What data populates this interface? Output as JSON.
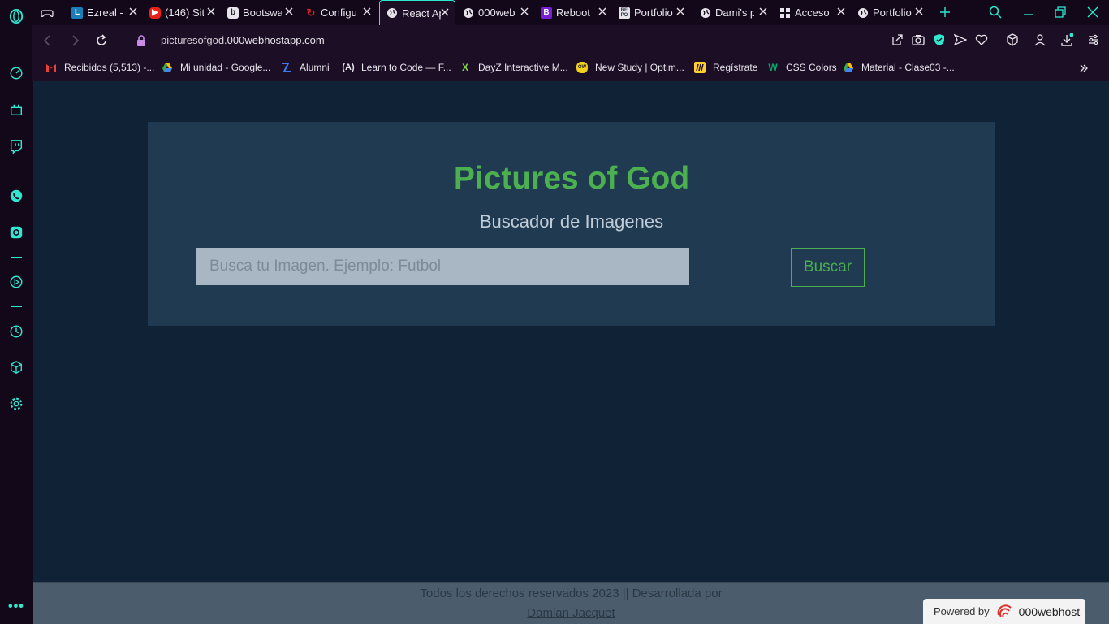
{
  "colors": {
    "accent": "#2ee8d0",
    "title_green": "#4caf50",
    "page_bg": "#0f2236",
    "hero_bg": "#203a51"
  },
  "tabs": [
    {
      "title": "",
      "icon": "gamepad-icon"
    },
    {
      "title": "Ezreal - ",
      "icon": "L"
    },
    {
      "title": "(146) Sit",
      "icon": "youtube-icon"
    },
    {
      "title": "Bootswa",
      "icon": "b"
    },
    {
      "title": "Configu",
      "icon": "red-swirl-icon"
    },
    {
      "title": "React Ap",
      "icon": "globe-icon"
    },
    {
      "title": "000web",
      "icon": "globe-icon"
    },
    {
      "title": "Reboot",
      "icon": "B"
    },
    {
      "title": "Portfolio",
      "icon": "repo-icon"
    },
    {
      "title": "Dami's p",
      "icon": "globe-icon"
    },
    {
      "title": "Acceso",
      "icon": "apps-icon"
    },
    {
      "title": "Portfolio",
      "icon": "globe-icon"
    }
  ],
  "address": {
    "domain_prefix": "picturesofgod.",
    "domain_main": "000webhostapp.com"
  },
  "bookmarks": [
    {
      "label": "Recibidos (5,513) -...",
      "icon": "gmail-icon"
    },
    {
      "label": "Mi unidad - Google...",
      "icon": "drive-icon"
    },
    {
      "label": "Alumni",
      "icon": "alumni-icon"
    },
    {
      "label": "Learn to Code — F...",
      "icon": "freecodecamp-icon"
    },
    {
      "label": "DayZ Interactive M...",
      "icon": "x-icon"
    },
    {
      "label": "New Study | Optim...",
      "icon": "ow-icon"
    },
    {
      "label": "Regístrate",
      "icon": "miro-icon"
    },
    {
      "label": "CSS Colors",
      "icon": "w3-icon"
    },
    {
      "label": "Material - Clase03 -...",
      "icon": "drive-icon"
    }
  ],
  "hero": {
    "title": "Pictures of God",
    "subtitle": "Buscador de Imagenes",
    "search_placeholder": "Busca tu Imagen. Ejemplo: Futbol",
    "search_button": "Buscar"
  },
  "footer": {
    "text": "Todos los derechos reservados 2023 || Desarrollada por",
    "author": "Damian Jacquet"
  },
  "powered": {
    "label": "Powered by",
    "brand": "000webhost"
  }
}
